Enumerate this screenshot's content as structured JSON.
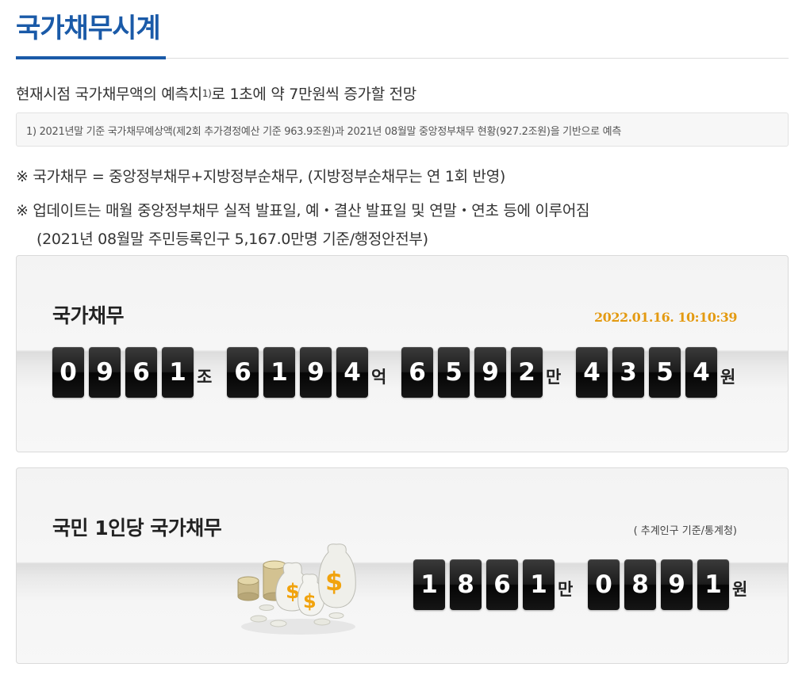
{
  "page": {
    "title": "국가채무시계"
  },
  "intro": {
    "lead_prefix": "현재시점 국가채무액의 예측치",
    "lead_sup": "1)",
    "lead_suffix": "로 1초에 약 7만원씩 증가할 전망",
    "footnote": "1) 2021년말 기준 국가채무예상액(제2회 추가경정예산 기준 963.9조원)과 2021년 08월말 중앙정부채무 현황(927.2조원)을 기반으로 예측"
  },
  "notes": {
    "note1": "※ 국가채무 = 중앙정부채무+지방정부순채무, (지방정부순채무는 연 1회 반영)",
    "note2": "※ 업데이트는 매월 중앙정부채무 실적 발표일, 예・결산 발표일 및 연말・연초 등에 이루어짐",
    "note3": "(2021년 08월말 주민등록인구 5,167.0만명 기준/행정안전부)"
  },
  "national_debt": {
    "title": "국가채무",
    "timestamp": "2022.01.16. 10:10:39",
    "groups": [
      {
        "digits": [
          "0",
          "9",
          "6",
          "1"
        ],
        "unit": "조"
      },
      {
        "digits": [
          "6",
          "1",
          "9",
          "4"
        ],
        "unit": "억"
      },
      {
        "digits": [
          "6",
          "5",
          "9",
          "2"
        ],
        "unit": "만"
      },
      {
        "digits": [
          "4",
          "3",
          "5",
          "4"
        ],
        "unit": "원"
      }
    ]
  },
  "per_capita": {
    "title": "국민 1인당 국가채무",
    "basis": "( 추계인구 기준/통계청)",
    "groups": [
      {
        "digits": [
          "1",
          "8",
          "6",
          "1"
        ],
        "unit": "만"
      },
      {
        "digits": [
          "0",
          "8",
          "9",
          "1"
        ],
        "unit": "원"
      }
    ],
    "illustration": "money-bags-coins-icon"
  },
  "colors": {
    "brand": "#1a5aa8",
    "timestamp": "#e39a12",
    "digit_bg": "#111111"
  }
}
